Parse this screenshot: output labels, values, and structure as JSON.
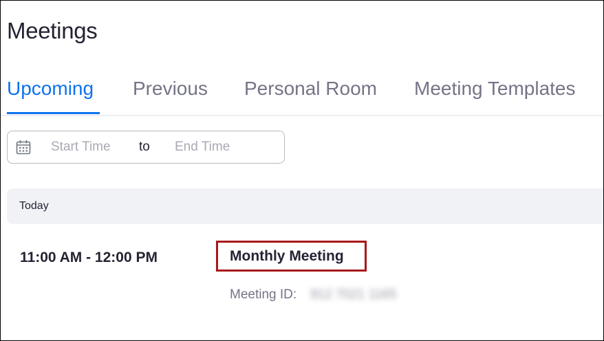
{
  "page": {
    "title": "Meetings"
  },
  "tabs": [
    {
      "label": "Upcoming",
      "active": true
    },
    {
      "label": "Previous",
      "active": false
    },
    {
      "label": "Personal Room",
      "active": false
    },
    {
      "label": "Meeting Templates",
      "active": false
    }
  ],
  "date_filter": {
    "icon": "calendar-icon",
    "start_placeholder": "Start Time",
    "separator": "to",
    "end_placeholder": "End Time"
  },
  "day_group": {
    "label": "Today"
  },
  "meeting": {
    "time": "11:00 AM - 12:00 PM",
    "title": "Monthly Meeting",
    "id_label": "Meeting ID:",
    "id_value": "912 7021 1165"
  },
  "colors": {
    "accent": "#0e72ed",
    "highlight_box": "#a8171a",
    "text": "#232333",
    "muted": "#747487"
  }
}
